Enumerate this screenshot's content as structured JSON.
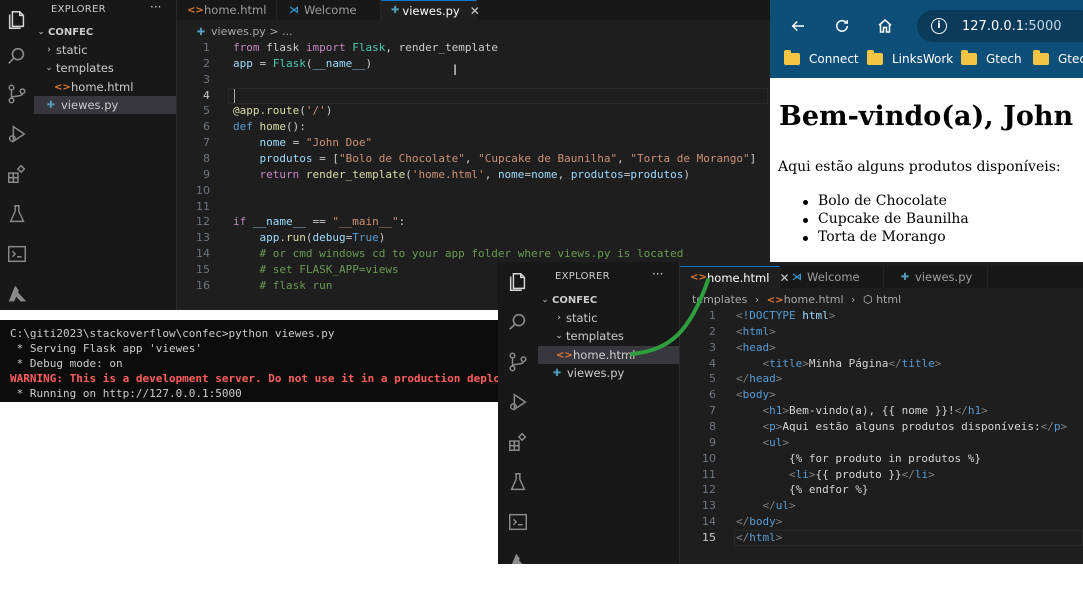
{
  "editor1": {
    "explorer_title": "EXPLORER",
    "more": "···",
    "folder": "CONFEC",
    "tree": [
      "static",
      "templates",
      "home.html",
      "viewes.py"
    ],
    "tabs": [
      {
        "label": "home.html"
      },
      {
        "label": "Welcome"
      },
      {
        "label": "viewes.py",
        "close": "✕"
      }
    ],
    "breadcrumb": "viewes.py > ...",
    "line_numbers": [
      "1",
      "2",
      "3",
      "4",
      "5",
      "6",
      "7",
      "8",
      "9",
      "10",
      "11",
      "12",
      "13",
      "14",
      "15",
      "16"
    ]
  },
  "terminal": {
    "lines": [
      "C:\\giti2023\\stackoverflow\\confec>python viewes.py",
      " * Serving Flask app 'viewes'",
      " * Debug mode: on",
      "WARNING: This is a development server. Do not use it in a production deployment. U",
      " * Running on http://127.0.0.1:5000"
    ]
  },
  "browser": {
    "url_host": "127.0.0.1",
    "url_port": ":5000",
    "bookmarks": [
      "Connect",
      "LinksWork",
      "Gtech",
      "Gtec"
    ],
    "h1": "Bem-vindo(a), John Doe",
    "paragraph": "Aqui estão alguns produtos disponíveis:",
    "items": [
      "Bolo de Chocolate",
      "Cupcake de Baunilha",
      "Torta de Morango"
    ]
  },
  "editor2": {
    "explorer_title": "EXPLORER",
    "more": "···",
    "folder": "CONFEC",
    "tree": [
      "static",
      "templates",
      "home.html",
      "viewes.py"
    ],
    "tabs": [
      {
        "label": "home.html",
        "close": "✕"
      },
      {
        "label": "Welcome"
      },
      {
        "label": "viewes.py"
      }
    ],
    "breadcrumb_parts": [
      "templates",
      "home.html",
      "html"
    ],
    "line_numbers": [
      "1",
      "2",
      "3",
      "4",
      "5",
      "6",
      "7",
      "8",
      "9",
      "10",
      "11",
      "12",
      "13",
      "14",
      "15"
    ]
  },
  "colors": {
    "accent": "#0078d4",
    "browser_toolbar": "#0d4f79",
    "arrow": "#2e9e3f",
    "warning": "#ff5f5f"
  }
}
